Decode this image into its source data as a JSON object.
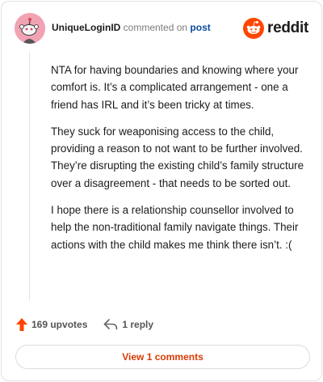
{
  "header": {
    "username": "UniqueLoginID",
    "commented_text": "commented on",
    "post_link": "post",
    "brand": "reddit"
  },
  "comment": {
    "paragraphs": [
      "NTA for having boundaries and knowing where your comfort is. It’s a complicated arrangement - one a friend has IRL and it’s been tricky at times.",
      "They suck for weaponising access to the child, providing a reason to not want to be further involved. They’re disrupting the existing child’s family structure over a disagreement - that needs to be sorted out.",
      "I hope there is a relationship counsellor involved to help the non-traditional family navigate things. Their actions with the child makes me think there isn’t. :("
    ]
  },
  "actions": {
    "upvotes": "169 upvotes",
    "reply": "1 reply"
  },
  "view_comments": "View 1 comments",
  "colors": {
    "brand_orange": "#ff4500",
    "upvote": "#ff4500",
    "link_blue": "#0a4a9c",
    "view_text": "#d93a00"
  },
  "icons": {
    "avatar": "snoo-avatar",
    "brand": "reddit-logo-icon",
    "upvote": "upvote-arrow-icon",
    "reply": "reply-arrow-icon"
  }
}
